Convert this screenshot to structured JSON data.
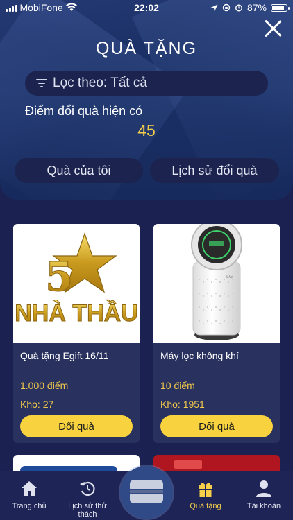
{
  "status_bar": {
    "carrier": "MobiFone",
    "time": "22:02",
    "battery": "87%",
    "battery_level": 0.87
  },
  "header": {
    "title": "QUÀ TẶNG",
    "filter_label": "Lọc theo: Tất cả",
    "points_label": "Điểm đổi quà hiện có",
    "points_value": "45",
    "tabs": {
      "my_gifts": "Quà của tôi",
      "history": "Lịch sử đổi quà"
    }
  },
  "gifts": [
    {
      "title": "Quà tặng Egift 16/11",
      "points": "1.000 điểm",
      "stock": "Kho: 27",
      "button": "Đổi quà",
      "image_text": "NHÀ THẦU",
      "image_badge": "5"
    },
    {
      "title": "Máy lọc không khí",
      "points": "10 điểm",
      "stock": "Kho: 1951",
      "button": "Đổi quà",
      "image_badge": "LG"
    }
  ],
  "bottom_nav": [
    {
      "label": "Trang chủ",
      "icon": "home-icon"
    },
    {
      "label": "Lịch sử thử thách",
      "icon": "history-icon"
    },
    {
      "label": "Quà tặng",
      "icon": "gift-icon",
      "active": true
    },
    {
      "label": "Tài khoản",
      "icon": "user-icon"
    }
  ],
  "colors": {
    "accent": "#f6cf4a",
    "background": "#1b2150",
    "card": "#29315e"
  }
}
